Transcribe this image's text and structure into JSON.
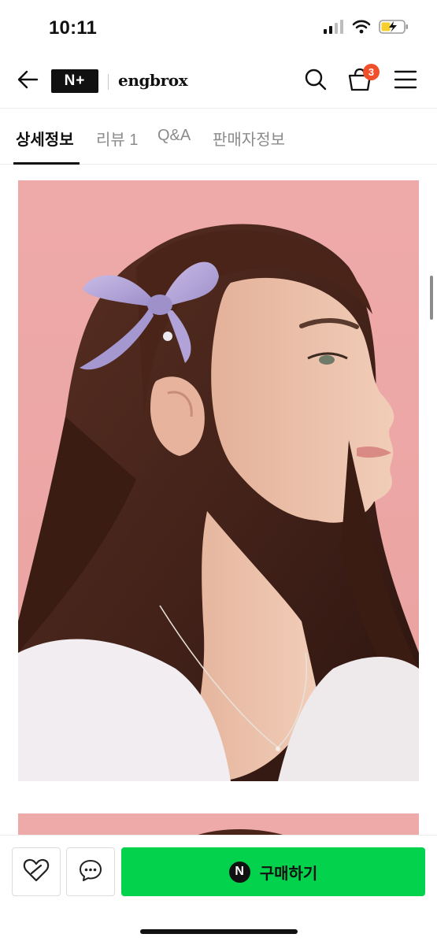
{
  "status_bar": {
    "time": "10:11",
    "icons": [
      "cellular-signal-icon",
      "wifi-icon",
      "battery-charging-icon"
    ]
  },
  "header": {
    "platform_logo": "N+",
    "store_name": "engbrox",
    "cart_count": "3",
    "icons": [
      "back-arrow-icon",
      "search-icon",
      "shopping-bag-icon",
      "menu-icon"
    ]
  },
  "tabs": [
    {
      "label": "상세정보",
      "active": true
    },
    {
      "label": "리뷰 1",
      "active": false
    },
    {
      "label": "Q&A",
      "active": false
    },
    {
      "label": "판매자정보",
      "active": false
    }
  ],
  "product": {
    "images": [
      "hair-bow-model-photo",
      "product-photo-2"
    ]
  },
  "bottom_bar": {
    "buy_icon": "N",
    "buy_label": "구매하기",
    "icons": [
      "heart-outline-icon",
      "chat-bubble-icon"
    ]
  },
  "colors": {
    "accent_green": "#03d24c",
    "badge_red": "#f14f2a",
    "photo_background": "#eeaaa8"
  }
}
